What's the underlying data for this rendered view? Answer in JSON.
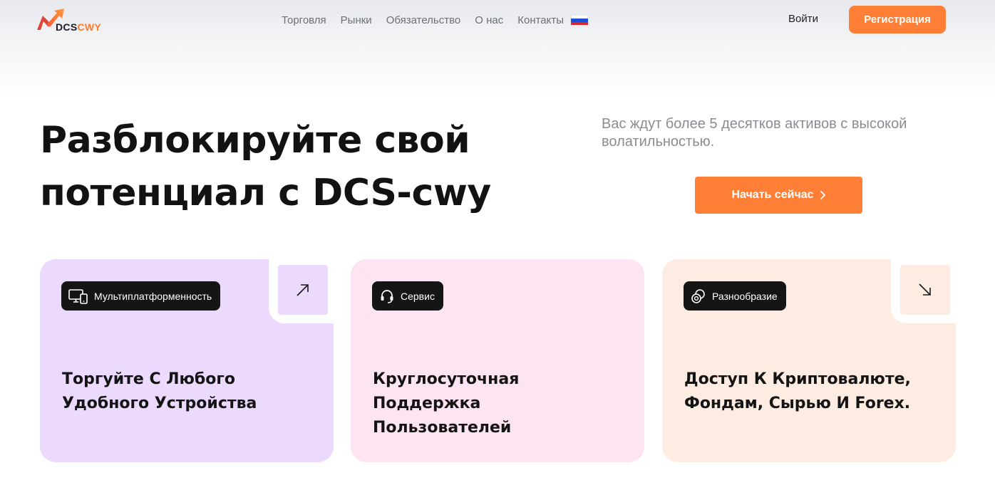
{
  "header": {
    "logo": {
      "part1": "DCS",
      "part2": "CWY"
    },
    "nav": [
      "Торговля",
      "Рынки",
      "Обязательство",
      "О нас",
      "Контакты"
    ],
    "language_flag": "russia-flag",
    "login_label": "Войти",
    "register_label": "Регистрация"
  },
  "hero": {
    "title_line1": "Разблокируйте свой",
    "title_line2": "потенциал с DCS-cwy",
    "subtitle": "Вас ждут более 5 десятков активов с высокой волатильностью.",
    "cta_label": "Начать сейчас",
    "cta_icon": "chevron-right-icon"
  },
  "cards": [
    {
      "tag": "Мультиплатформенность",
      "tag_icon": "devices-icon",
      "title_line1": "Торгуйте С Любого",
      "title_line2": "Удобного Устройства",
      "title_line3": "",
      "arrow_icon": "arrow-up-right-icon",
      "color": "#ebdafd"
    },
    {
      "tag": "Сервис",
      "tag_icon": "headset-icon",
      "title_line1": "Круглосуточная",
      "title_line2": "Поддержка",
      "title_line3": "Пользователей",
      "arrow_icon": "",
      "color": "#fde4f3"
    },
    {
      "tag": "Разнообразие",
      "tag_icon": "coins-icon",
      "title_line1": "Доступ К Криптовалюте,",
      "title_line2": "Фондам, Сырью И Forex.",
      "title_line3": "",
      "arrow_icon": "arrow-down-right-icon",
      "color": "#fdece1"
    }
  ],
  "colors": {
    "accent": "#ff7f36",
    "dark": "#151515",
    "muted_text": "#8a8c92"
  }
}
